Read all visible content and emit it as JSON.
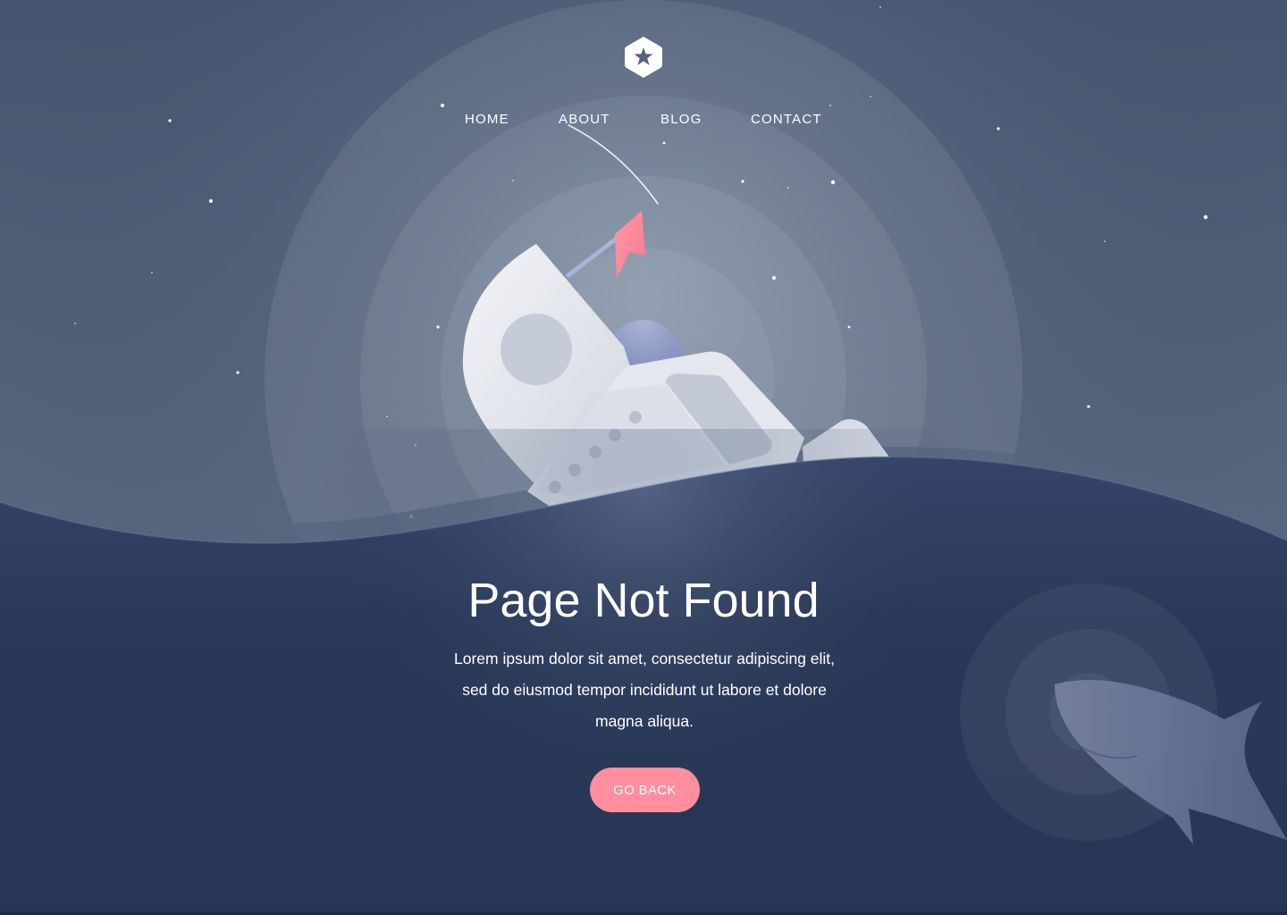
{
  "logo": {
    "icon": "star-hexagon-icon"
  },
  "nav": {
    "items": [
      {
        "label": "HOME"
      },
      {
        "label": "ABOUT"
      },
      {
        "label": "BLOG"
      },
      {
        "label": "CONTACT"
      }
    ]
  },
  "hero": {
    "title": "Page Not Found",
    "description": "Lorem ipsum dolor sit amet, consectetur adipiscing elit, sed do eiusmod tempor incididunt ut labore et dolore magna aliqua.",
    "button_label": "GO BACK"
  },
  "colors": {
    "sky": "#4c5a75",
    "ocean": "#293656",
    "accent": "#ff8e9f",
    "text": "#ffffff"
  }
}
